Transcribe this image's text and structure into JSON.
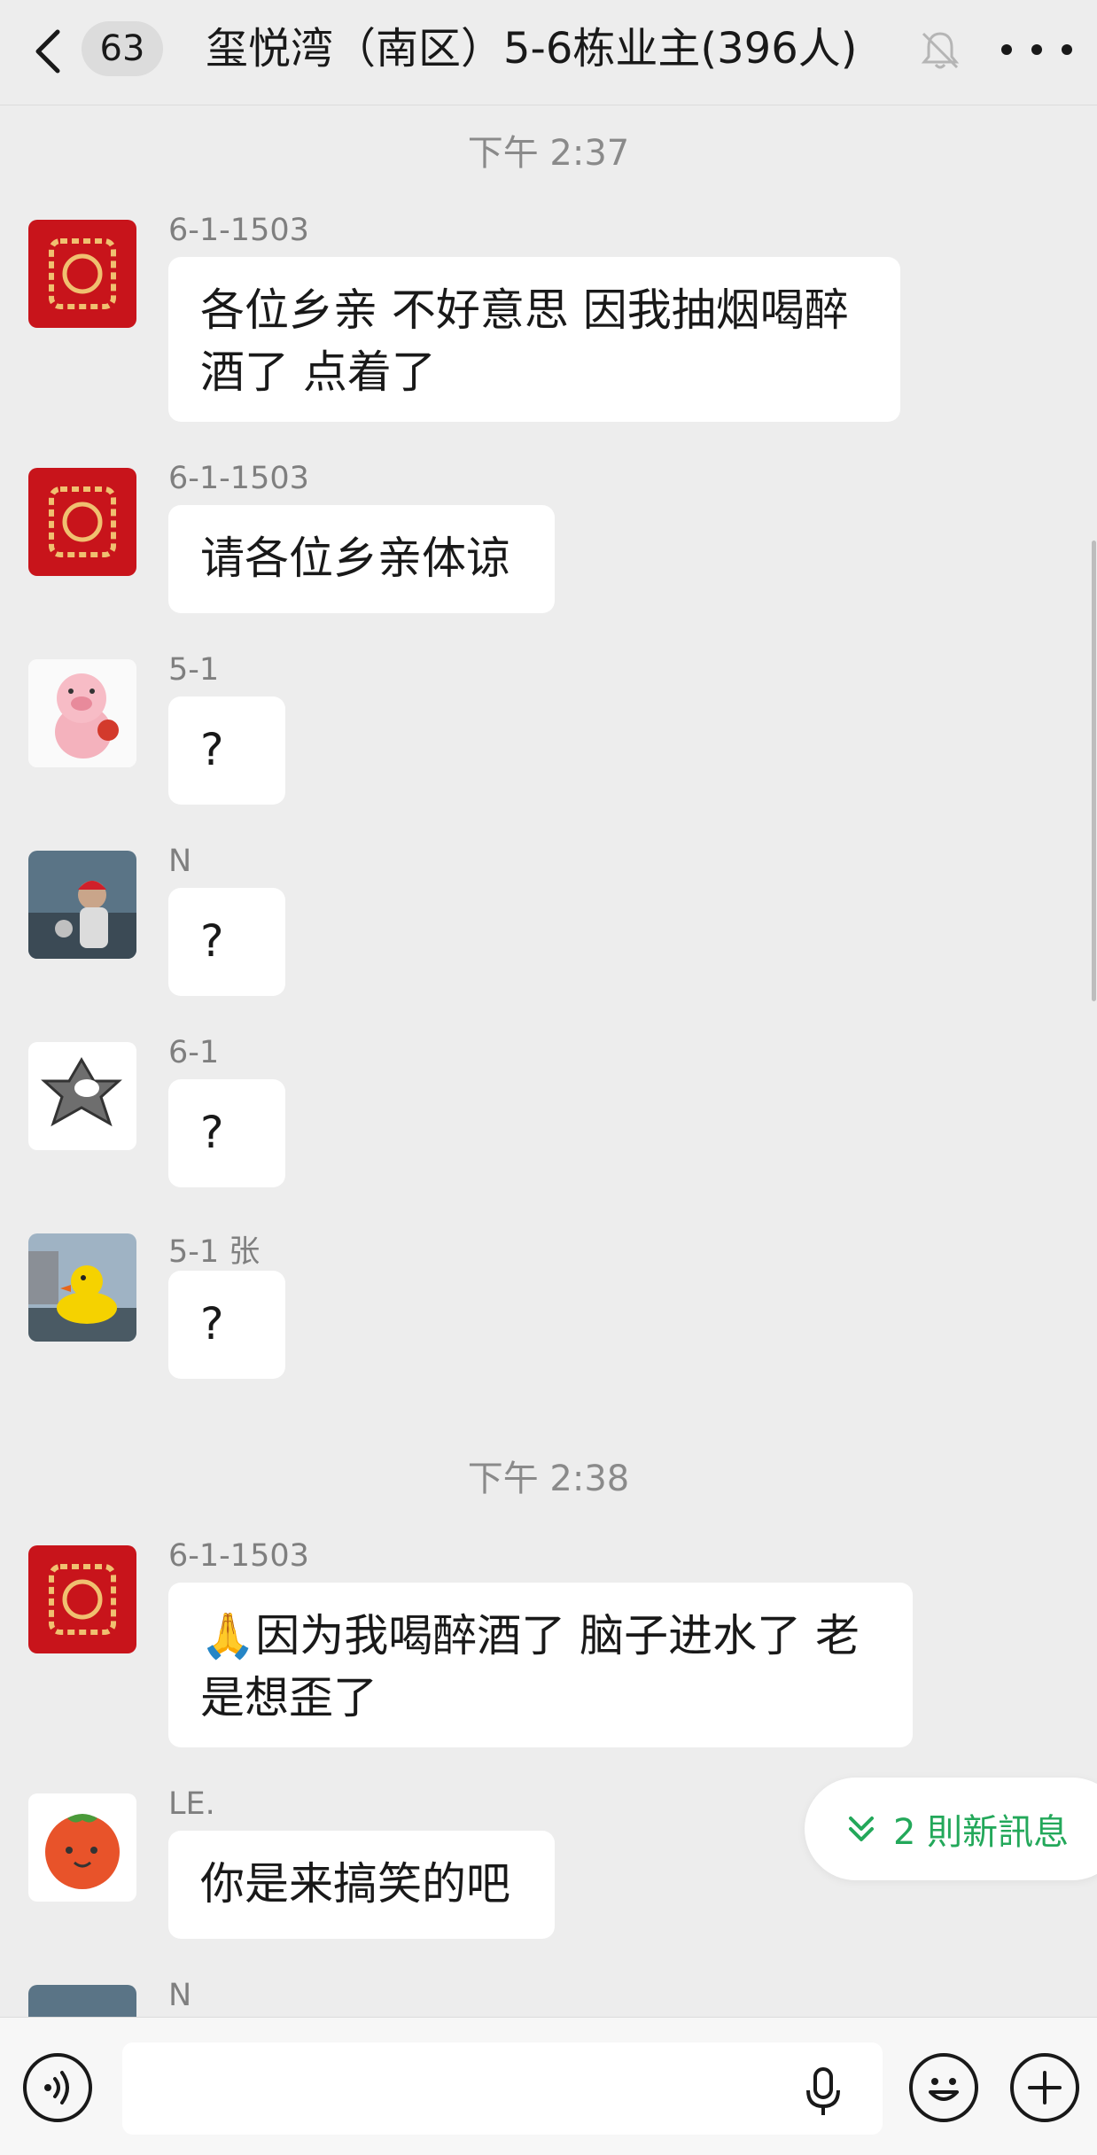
{
  "header": {
    "unread_count": "63",
    "title": "玺悦湾（南区）5-6栋业主(396人)"
  },
  "timestamps": [
    "下午 2:37",
    "下午 2:38"
  ],
  "messages": [
    {
      "sender": "6-1-1503",
      "text": "各位乡亲 不好意思 因我抽烟喝醉酒了 点着了"
    },
    {
      "sender": "6-1-1503",
      "text": "请各位乡亲体谅"
    },
    {
      "sender": "5-1",
      "text": "?"
    },
    {
      "sender": "N",
      "text": "?"
    },
    {
      "sender": "6-1",
      "text": "?"
    },
    {
      "sender": "5-1 张",
      "text": "?"
    },
    {
      "sender": "6-1-1503",
      "emoji": "🙏",
      "text": "因为我喝醉酒了 脑子进水了 老是想歪了"
    },
    {
      "sender": "LE.",
      "text": "你是来搞笑的吧"
    },
    {
      "sender": "N",
      "text": ""
    }
  ],
  "new_messages": {
    "label": "2 則新訊息"
  },
  "colors": {
    "background": "#ededed",
    "bubble": "#ffffff",
    "accent_green": "#23a85a"
  }
}
